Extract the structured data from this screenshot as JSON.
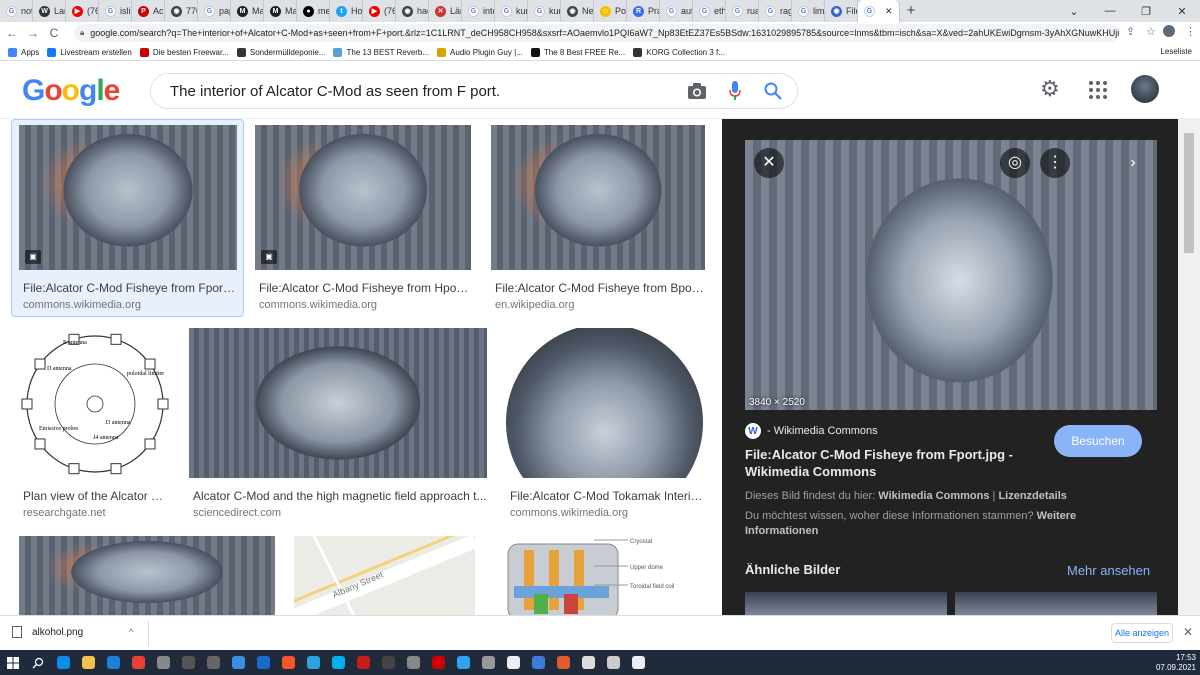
{
  "tabs": [
    {
      "label": "not",
      "fav": "G",
      "color": "#fff"
    },
    {
      "label": "Lar",
      "fav": "W",
      "color": "#333"
    },
    {
      "label": "(76",
      "fav": "▶",
      "color": "#e00"
    },
    {
      "label": "islie",
      "fav": "G",
      "color": "#fff"
    },
    {
      "label": "Ach",
      "fav": "P",
      "color": "#c00"
    },
    {
      "label": "770",
      "fav": "◉",
      "color": "#444"
    },
    {
      "label": "pap",
      "fav": "G",
      "color": "#fff"
    },
    {
      "label": "Ma",
      "fav": "M",
      "color": "#222"
    },
    {
      "label": "Ma",
      "fav": "M",
      "color": "#222"
    },
    {
      "label": "me",
      "fav": "●",
      "color": "#000"
    },
    {
      "label": "Hor",
      "fav": "t",
      "color": "#1da1f2"
    },
    {
      "label": "(76",
      "fav": "▶",
      "color": "#e00"
    },
    {
      "label": "hac",
      "fav": "◉",
      "color": "#444"
    },
    {
      "label": "Län",
      "fav": "✕",
      "color": "#c33"
    },
    {
      "label": "inte",
      "fav": "G",
      "color": "#fff"
    },
    {
      "label": "kurs",
      "fav": "G",
      "color": "#fff"
    },
    {
      "label": "kurs",
      "fav": "G",
      "color": "#fff"
    },
    {
      "label": "Ne",
      "fav": "◉",
      "color": "#444"
    },
    {
      "label": "Pos",
      "fav": "☺",
      "color": "#f6c000"
    },
    {
      "label": "Pral",
      "fav": "R",
      "color": "#3a6ee8"
    },
    {
      "label": "auti",
      "fav": "G",
      "color": "#fff"
    },
    {
      "label": "eth",
      "fav": "G",
      "color": "#fff"
    },
    {
      "label": "ruas",
      "fav": "G",
      "color": "#fff"
    },
    {
      "label": "rag",
      "fav": "G",
      "color": "#fff"
    },
    {
      "label": "limi",
      "fav": "G",
      "color": "#fff"
    },
    {
      "label": "File",
      "fav": "◉",
      "color": "#36c"
    }
  ],
  "active_tab": {
    "fav": "G"
  },
  "window_controls": {
    "minimize": "—",
    "maximize": "❐",
    "close": "✕",
    "menu": "⌄"
  },
  "newtab_label": "+",
  "nav": {
    "back": "←",
    "forward": "→",
    "reload": "C"
  },
  "url": "google.com/search?q=The+interior+of+Alcator+C-Mod+as+seen+from+F+port.&rlz=1C1LRNT_deCH958CH958&sxsrf=AOaemvlo1PQI6aW7_Np83EtEZ37Es5BSdw:1631029895785&source=lnms&tbm=isch&sa=X&ved=2ahUKEwiDgrnsm-3yAhXGNuwKHUji...",
  "bookmarks": [
    {
      "label": "Apps",
      "color": "#4285f4"
    },
    {
      "label": "Livestream erstellen",
      "color": "#1877f2"
    },
    {
      "label": "Die besten Freewar...",
      "color": "#c00"
    },
    {
      "label": "Sondermülldeponie...",
      "color": "#333"
    },
    {
      "label": "The 13 BEST Reverb...",
      "color": "#5aa0d8"
    },
    {
      "label": "Audio Plugin Guy |...",
      "color": "#d9a400"
    },
    {
      "label": "The 8 Best FREE Re...",
      "color": "#111"
    },
    {
      "label": "KORG Collection 3 f...",
      "color": "#333"
    }
  ],
  "reading_list": "Leseliste",
  "search": {
    "query": "The interior of Alcator C-Mod as seen from F port."
  },
  "logo_letters": [
    {
      "ch": "G",
      "color": "#4285f4"
    },
    {
      "ch": "o",
      "color": "#ea4335"
    },
    {
      "ch": "o",
      "color": "#fbbc05"
    },
    {
      "ch": "g",
      "color": "#4285f4"
    },
    {
      "ch": "l",
      "color": "#34a853"
    },
    {
      "ch": "e",
      "color": "#ea4335"
    }
  ],
  "results": [
    {
      "title": "File:Alcator C-Mod Fisheye from Fport.j...",
      "source": "commons.wikimedia.org",
      "style": "tok",
      "badge": "▣"
    },
    {
      "title": "File:Alcator C-Mod Fisheye from Hport....",
      "source": "commons.wikimedia.org",
      "style": "tok",
      "badge": "▣"
    },
    {
      "title": "File:Alcator C-Mod Fisheye from Bport...",
      "source": "en.wikipedia.org",
      "style": "tok"
    },
    {
      "title": "Plan view of the Alcator C-...",
      "source": "researchgate.net",
      "style": "plan"
    },
    {
      "title": "Alcator C-Mod and the high magnetic field approach t...",
      "source": "sciencedirect.com",
      "style": "tok2"
    },
    {
      "title": "File:Alcator C-Mod Tokamak Interio...",
      "source": "commons.wikimedia.org",
      "style": "fish"
    },
    {
      "style": "tok"
    },
    {
      "style": "map",
      "map_label": "Albany Street"
    },
    {
      "style": "diagram",
      "labels": [
        "Cryostat",
        "Upper dome",
        "Toroidal field coil"
      ]
    }
  ],
  "plan_labels": [
    "E antenna",
    "D antenna",
    "poloidal limiter",
    "J3 antenna",
    "J4 antenna",
    "Emissive probes"
  ],
  "panel": {
    "dims": "3840 × 2520",
    "source": "- Wikimedia Commons",
    "visit": "Besuchen",
    "title": "File:Alcator C-Mod Fisheye from Fport.jpg - Wikimedia Commons",
    "found_prefix": "Dieses Bild findest du hier:",
    "found_link": "Wikimedia Commons",
    "found_sep": "|",
    "license": "Lizenzdetails",
    "ask": "Du möchtest wissen, woher diese Informationen stammen?",
    "ask_more": "Weitere Informationen",
    "similar": "Ähnliche Bilder",
    "more": "Mehr ansehen",
    "icons": {
      "close": "✕",
      "lens": "◎",
      "more": "⋮",
      "next": "›"
    }
  },
  "downloads": {
    "file": "alkohol.png",
    "show_all": "Alle anzeigen",
    "chevron": "^",
    "close": "✕"
  },
  "taskbar": {
    "time": "17:53",
    "date": "07.09.2021",
    "apps": [
      {
        "name": "start-icon",
        "color": "#fff"
      },
      {
        "name": "search-icon",
        "color": "#fff"
      },
      {
        "name": "edge-icon",
        "color": "#0c8ce9"
      },
      {
        "name": "explorer-icon",
        "color": "#f4c04a"
      },
      {
        "name": "mail-icon",
        "color": "#1c7ed6"
      },
      {
        "name": "chrome-icon",
        "color": "#e94235"
      },
      {
        "name": "app-icon",
        "color": "#888"
      },
      {
        "name": "app-icon",
        "color": "#555"
      },
      {
        "name": "live-icon",
        "color": "#666"
      },
      {
        "name": "app-icon",
        "color": "#3a8ee6"
      },
      {
        "name": "app-icon",
        "color": "#1b6ac9"
      },
      {
        "name": "brave-icon",
        "color": "#fb542b"
      },
      {
        "name": "telegram-icon",
        "color": "#2aa3df"
      },
      {
        "name": "skype-icon",
        "color": "#00aff0"
      },
      {
        "name": "app-icon",
        "color": "#c41b1b"
      },
      {
        "name": "app-icon",
        "color": "#444"
      },
      {
        "name": "app-icon",
        "color": "#888"
      },
      {
        "name": "app-icon",
        "color": "#c00"
      },
      {
        "name": "app-icon",
        "color": "#2ea3f2"
      },
      {
        "name": "app-icon",
        "color": "#999"
      },
      {
        "name": "app-icon",
        "color": "#eee"
      },
      {
        "name": "app-icon",
        "color": "#3e7bd6"
      },
      {
        "name": "app-icon",
        "color": "#e05a2b"
      },
      {
        "name": "app-icon",
        "color": "#ddd"
      },
      {
        "name": "app-icon",
        "color": "#ccc"
      },
      {
        "name": "app-icon",
        "color": "#eee"
      }
    ]
  }
}
